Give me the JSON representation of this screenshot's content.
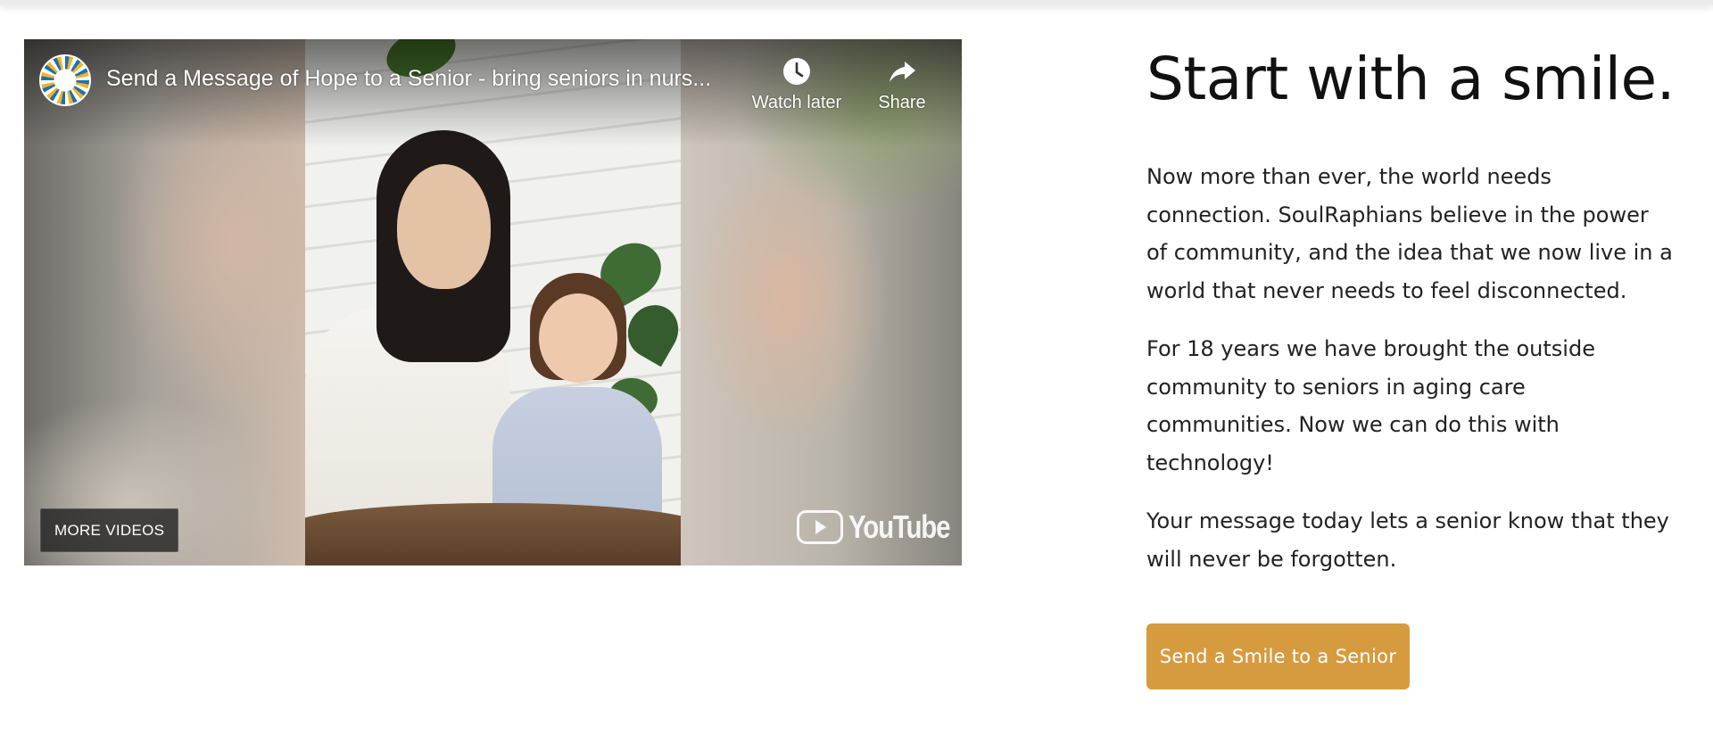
{
  "video": {
    "title": "Send a Message of Hope to a Senior - bring seniors in nurs...",
    "watch_later_label": "Watch later",
    "share_label": "Share",
    "more_videos_label": "MORE VIDEOS",
    "platform_logo_text": "YouTube",
    "channel_logo_icon": "sunburst-logo-icon"
  },
  "section": {
    "title": "Start with a smile.",
    "paragraphs": [
      "Now more than ever, the world needs connection. SoulRaphians believe in the power of community, and the idea that we now live in a world that never needs to feel disconnected.",
      "For 18 years we have brought the outside community to seniors in aging care communities. Now we can do this with technology!",
      "Your message today lets a senior know that they will never be forgotten."
    ],
    "cta_label": "Send a Smile to a Senior"
  },
  "colors": {
    "cta_background": "#d79b3f",
    "heading_text": "#111111",
    "body_text": "#222222"
  }
}
